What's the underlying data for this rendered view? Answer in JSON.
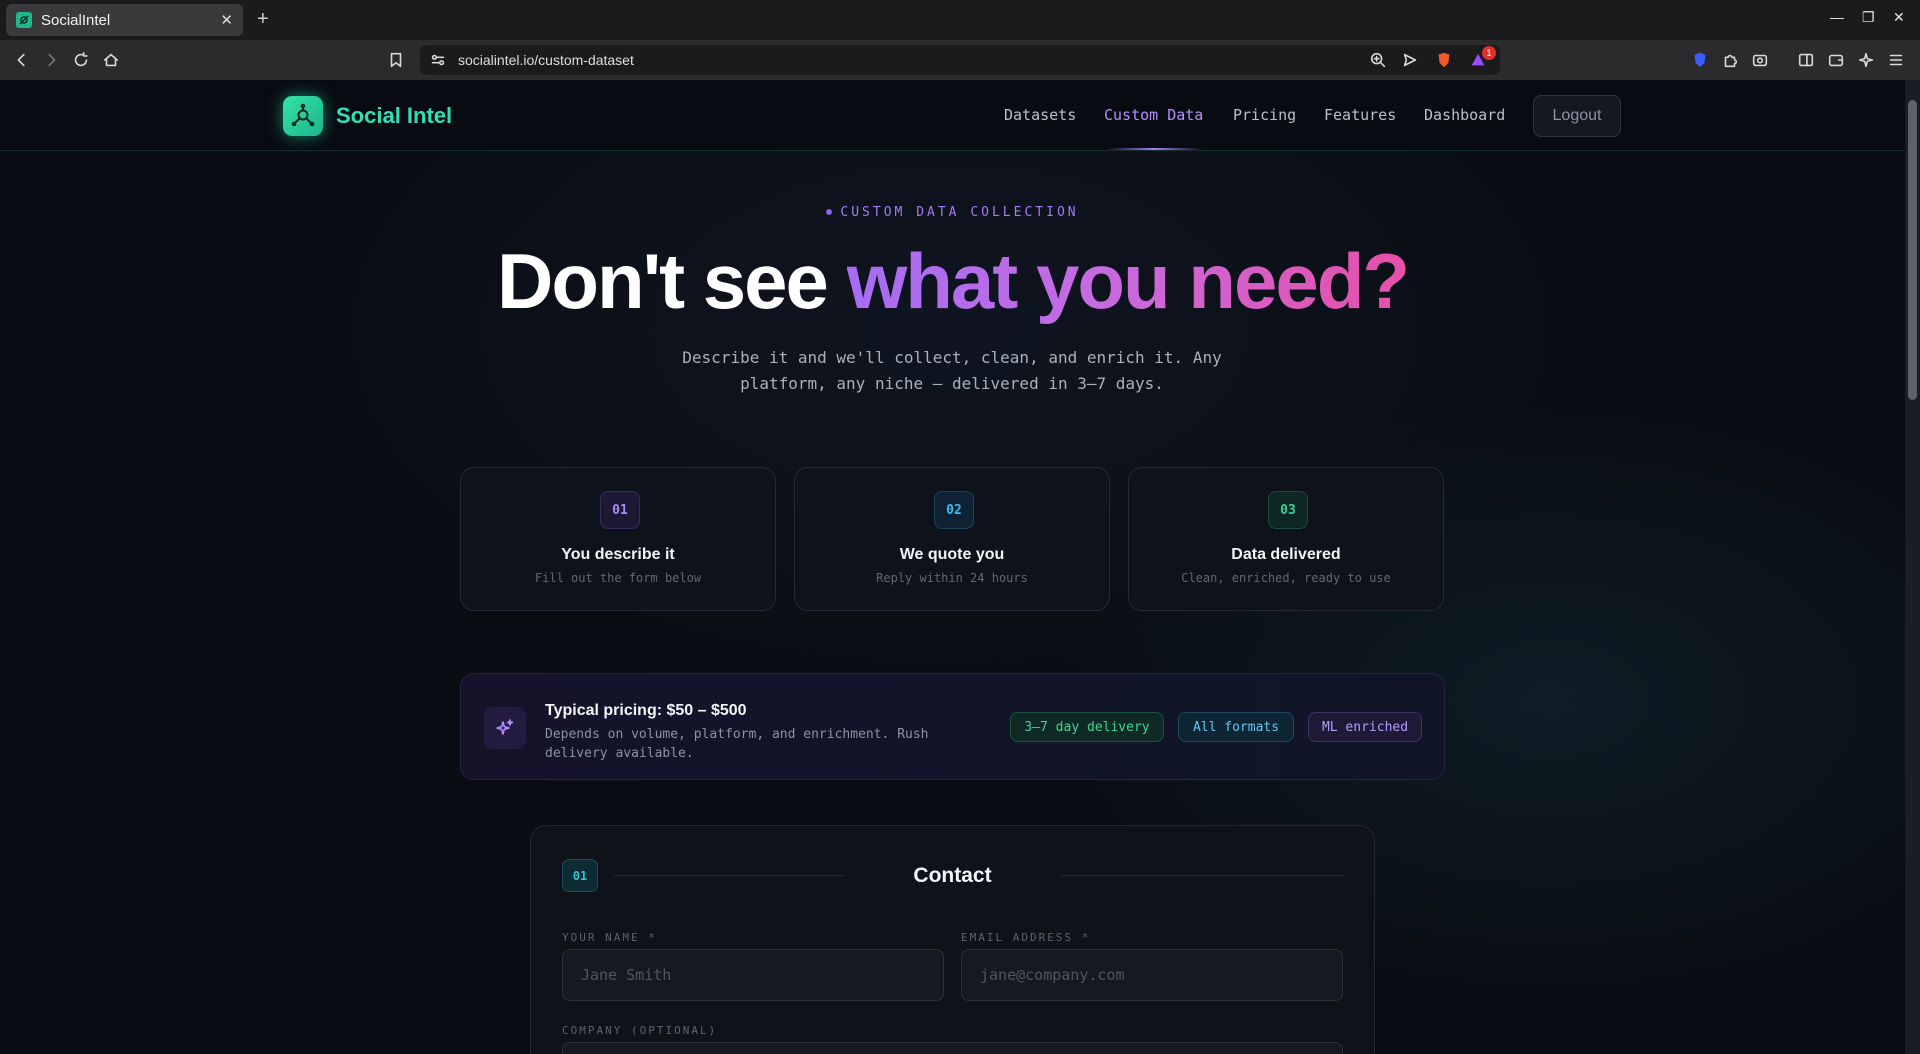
{
  "browser": {
    "tab_title": "SocialIntel",
    "tab_close": "✕",
    "new_tab": "+",
    "url": "socialintel.io/custom-dataset",
    "minimize": "—",
    "restore": "❐",
    "close": "✕",
    "notification_count": "1"
  },
  "nav": {
    "brand": "Social Intel",
    "links": [
      "Datasets",
      "Custom Data",
      "Pricing",
      "Features",
      "Dashboard"
    ],
    "active": "Custom Data",
    "logout": "Logout"
  },
  "hero": {
    "eyebrow": "CUSTOM DATA COLLECTION",
    "headline_plain": "Don't see ",
    "headline_accent": "what you need?",
    "subtitle": "Describe it and we'll collect, clean, and enrich it. Any platform, any niche — delivered in 3–7 days."
  },
  "steps": [
    {
      "num": "01",
      "title": "You describe it",
      "desc": "Fill out the form below",
      "accent": "#a78bfa"
    },
    {
      "num": "02",
      "title": "We quote you",
      "desc": "Reply within 24 hours",
      "accent": "#38bdf8"
    },
    {
      "num": "03",
      "title": "Data delivered",
      "desc": "Clean, enriched, ready to use",
      "accent": "#34d399"
    }
  ],
  "pricing": {
    "title": "Typical pricing: $50 – $500",
    "desc": "Depends on volume, platform, and enrichment. Rush delivery available.",
    "chips": [
      "3–7 day delivery",
      "All formats",
      "ML enriched"
    ]
  },
  "form": {
    "section_num": "01",
    "section_title": "Contact",
    "name_label": "YOUR NAME *",
    "name_placeholder": "Jane Smith",
    "email_label": "EMAIL ADDRESS *",
    "email_placeholder": "jane@company.com",
    "company_label": "COMPANY (OPTIONAL)"
  },
  "colors": {
    "brand": "#2ee0b4",
    "active_nav": "#b78cff",
    "background": "#0a0e14"
  }
}
